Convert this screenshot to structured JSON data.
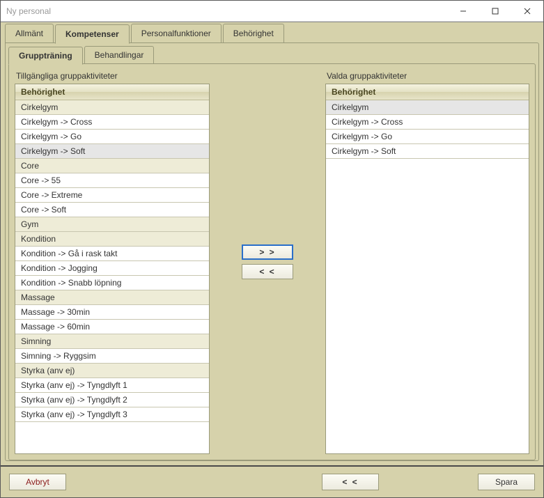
{
  "window": {
    "title": "Ny personal"
  },
  "tabs": {
    "items": [
      {
        "label": "Allmänt"
      },
      {
        "label": "Kompetenser"
      },
      {
        "label": "Personalfunktioner"
      },
      {
        "label": "Behörighet"
      }
    ],
    "activeIndex": 1
  },
  "subtabs": {
    "items": [
      {
        "label": "Gruppträning"
      },
      {
        "label": "Behandlingar"
      }
    ],
    "activeIndex": 0
  },
  "available": {
    "title": "Tillgängliga gruppaktiviteter",
    "header": "Behörighet",
    "rows": [
      {
        "label": "Cirkelgym",
        "cat": true
      },
      {
        "label": "Cirkelgym -> Cross"
      },
      {
        "label": "Cirkelgym -> Go"
      },
      {
        "label": "Cirkelgym -> Soft",
        "selected": true
      },
      {
        "label": "Core",
        "cat": true
      },
      {
        "label": "Core -> 55"
      },
      {
        "label": "Core -> Extreme"
      },
      {
        "label": "Core -> Soft"
      },
      {
        "label": "Gym",
        "cat": true
      },
      {
        "label": "Kondition",
        "cat": true
      },
      {
        "label": "Kondition -> Gå i rask takt"
      },
      {
        "label": "Kondition -> Jogging"
      },
      {
        "label": "Kondition -> Snabb löpning"
      },
      {
        "label": "Massage",
        "cat": true
      },
      {
        "label": "Massage -> 30min"
      },
      {
        "label": "Massage -> 60min"
      },
      {
        "label": "Simning",
        "cat": true
      },
      {
        "label": "Simning -> Ryggsim"
      },
      {
        "label": "Styrka (anv ej)",
        "cat": true
      },
      {
        "label": "Styrka (anv ej) -> Tyngdlyft 1"
      },
      {
        "label": "Styrka (anv ej) -> Tyngdlyft 2"
      },
      {
        "label": "Styrka (anv ej) -> Tyngdlyft 3"
      }
    ]
  },
  "selected": {
    "title": "Valda gruppaktiviteter",
    "header": "Behörighet",
    "rows": [
      {
        "label": "Cirkelgym",
        "selected": true
      },
      {
        "label": "Cirkelgym -> Cross"
      },
      {
        "label": "Cirkelgym -> Go"
      },
      {
        "label": "Cirkelgym -> Soft"
      }
    ]
  },
  "moveButtons": {
    "add": "> >",
    "remove": "< <"
  },
  "bottom": {
    "cancel": "Avbryt",
    "prev": "< <",
    "save": "Spara"
  }
}
